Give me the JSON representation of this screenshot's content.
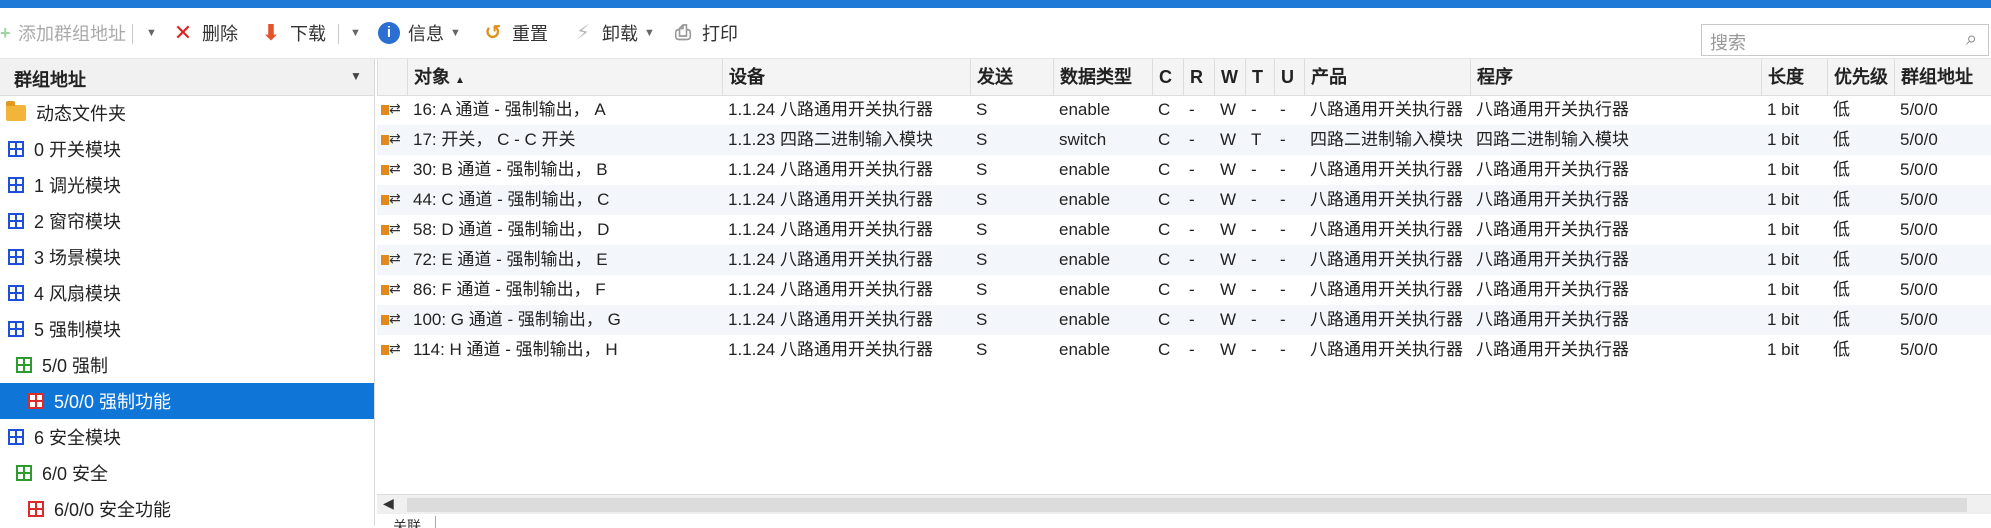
{
  "toolbar": {
    "add_group": "添加群组地址",
    "delete": "删除",
    "download": "下载",
    "info": "信息",
    "reset": "重置",
    "unload": "卸载",
    "print": "打印",
    "search_placeholder": "搜索"
  },
  "tree": {
    "header": "群组地址",
    "items": [
      {
        "label": "动态文件夹"
      },
      {
        "label": "0 开关模块"
      },
      {
        "label": "1 调光模块"
      },
      {
        "label": "2 窗帘模块"
      },
      {
        "label": "3 场景模块"
      },
      {
        "label": "4 风扇模块"
      },
      {
        "label": "5 强制模块"
      },
      {
        "label": "5/0 强制"
      },
      {
        "label": "5/0/0 强制功能"
      },
      {
        "label": "6 安全模块"
      },
      {
        "label": "6/0 安全"
      },
      {
        "label": "6/0/0 安全功能"
      }
    ]
  },
  "table": {
    "columns": [
      "对象",
      "设备",
      "发送",
      "数据类型",
      "C",
      "R",
      "W",
      "T",
      "U",
      "产品",
      "程序",
      "长度",
      "优先级",
      "群组地址"
    ],
    "rows": [
      [
        "16: A 通道 - 强制输出， A",
        "1.1.24 八路通用开关执行器",
        "S",
        "enable",
        "C",
        "-",
        "W",
        "-",
        "-",
        "八路通用开关执行器",
        "八路通用开关执行器",
        "1 bit",
        "低",
        "5/0/0"
      ],
      [
        "17: 开关， C - C 开关",
        "1.1.23 四路二进制输入模块",
        "S",
        "switch",
        "C",
        "-",
        "W",
        "T",
        "-",
        "四路二进制输入模块",
        "四路二进制输入模块",
        "1 bit",
        "低",
        "5/0/0"
      ],
      [
        "30: B 通道 - 强制输出， B",
        "1.1.24 八路通用开关执行器",
        "S",
        "enable",
        "C",
        "-",
        "W",
        "-",
        "-",
        "八路通用开关执行器",
        "八路通用开关执行器",
        "1 bit",
        "低",
        "5/0/0"
      ],
      [
        "44: C 通道 - 强制输出， C",
        "1.1.24 八路通用开关执行器",
        "S",
        "enable",
        "C",
        "-",
        "W",
        "-",
        "-",
        "八路通用开关执行器",
        "八路通用开关执行器",
        "1 bit",
        "低",
        "5/0/0"
      ],
      [
        "58: D 通道 - 强制输出， D",
        "1.1.24 八路通用开关执行器",
        "S",
        "enable",
        "C",
        "-",
        "W",
        "-",
        "-",
        "八路通用开关执行器",
        "八路通用开关执行器",
        "1 bit",
        "低",
        "5/0/0"
      ],
      [
        "72: E 通道 - 强制输出， E",
        "1.1.24 八路通用开关执行器",
        "S",
        "enable",
        "C",
        "-",
        "W",
        "-",
        "-",
        "八路通用开关执行器",
        "八路通用开关执行器",
        "1 bit",
        "低",
        "5/0/0"
      ],
      [
        "86: F 通道 - 强制输出， F",
        "1.1.24 八路通用开关执行器",
        "S",
        "enable",
        "C",
        "-",
        "W",
        "-",
        "-",
        "八路通用开关执行器",
        "八路通用开关执行器",
        "1 bit",
        "低",
        "5/0/0"
      ],
      [
        "100: G 通道 - 强制输出， G",
        "1.1.24 八路通用开关执行器",
        "S",
        "enable",
        "C",
        "-",
        "W",
        "-",
        "-",
        "八路通用开关执行器",
        "八路通用开关执行器",
        "1 bit",
        "低",
        "5/0/0"
      ],
      [
        "114: H 通道 - 强制输出， H",
        "1.1.24 八路通用开关执行器",
        "S",
        "enable",
        "C",
        "-",
        "W",
        "-",
        "-",
        "八路通用开关执行器",
        "八路通用开关执行器",
        "1 bit",
        "低",
        "5/0/0"
      ]
    ]
  },
  "bottom_tab": "关联",
  "colors": {
    "accent": "#0f76d8",
    "row_alt": "#f3f7fc"
  }
}
